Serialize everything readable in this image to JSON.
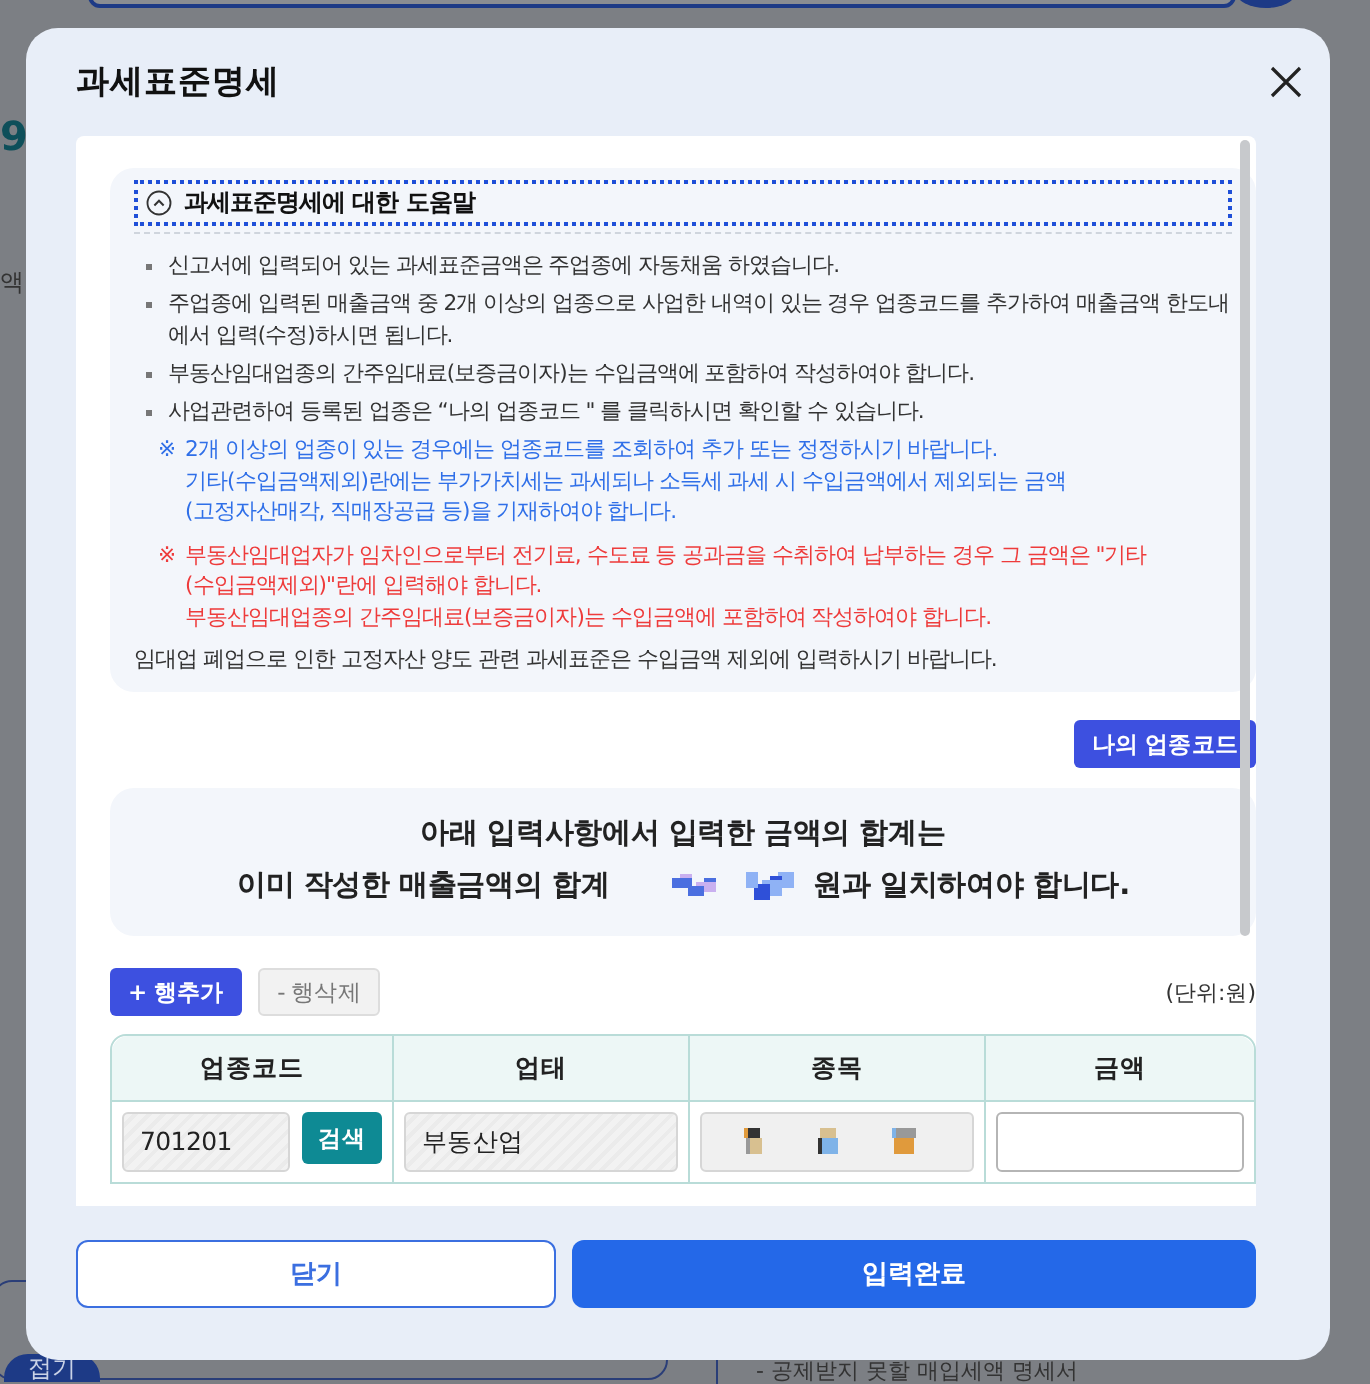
{
  "background": {
    "digit": "9",
    "label": "액",
    "collapse_button": "접기",
    "note": "- 공제받지 못할 매입세액 명세서"
  },
  "dialog": {
    "title": "과세표준명세"
  },
  "help": {
    "title": "과세표준명세에 대한 도움말",
    "expanded": true,
    "bullets": [
      "신고서에 입력되어 있는 과세표준금액은 주업종에 자동채움 하였습니다.",
      "주업종에 입력된 매출금액 중 2개 이상의 업종으로 사업한 내역이 있는 경우 업종코드를 추가하여 매출금액 한도내에서 입력(수정)하시면 됩니다.",
      "부동산임대업종의 간주임대료(보증금이자)는 수입금액에 포함하여 작성하여야 합니다.",
      "사업관련하여 등록된 업종은 “나의 업종코드 \" 를 클릭하시면 확인할 수 있습니다."
    ],
    "notes": [
      {
        "kind": "info",
        "mark": "※",
        "lines": [
          "2개 이상의 업종이 있는 경우에는 업종코드를 조회하여 추가 또는 정정하시기 바랍니다.",
          "기타(수입금액제외)란에는 부가가치세는 과세되나 소득세 과세 시 수입금액에서 제외되는 금액",
          "(고정자산매각, 직매장공급 등)을 기재하여야 합니다."
        ]
      },
      {
        "kind": "warning",
        "mark": "※",
        "lines": [
          "부동산임대업자가 임차인으로부터 전기료, 수도료 등 공과금을 수취하여 납부하는 경우 그 금액은 \"기타",
          "(수입금액제외)\"란에 입력해야 합니다.",
          "부동산임대업종의 간주임대료(보증금이자)는 수입금액에 포함하여 작성하여야 합니다."
        ]
      }
    ],
    "footer": "임대업 폐업으로 인한 고정자산 양도 관련 과세표준은 수입금액 제외에 입력하시기 바랍니다."
  },
  "my_code_button": "나의 업종코드",
  "summary": {
    "line_1": "아래 입력사항에서 입력한 금액의 합계는",
    "line_2_before": "이미 작성한 매출금액의 합계",
    "line_2_after": "원과 일치하여야 합니다."
  },
  "toolbar": {
    "add_button": "+ 행추가",
    "delete_button": "- 행삭제",
    "delete_disabled": true,
    "unit": "(단위:원)"
  },
  "table": {
    "columns": [
      "업종코드",
      "업태",
      "종목",
      "금액"
    ],
    "rows": [
      {
        "code": "701201",
        "search_button": "검색",
        "business_type": "부동산업"
      }
    ]
  },
  "buttons": {
    "close": "닫기",
    "confirm": "입력완료"
  }
}
